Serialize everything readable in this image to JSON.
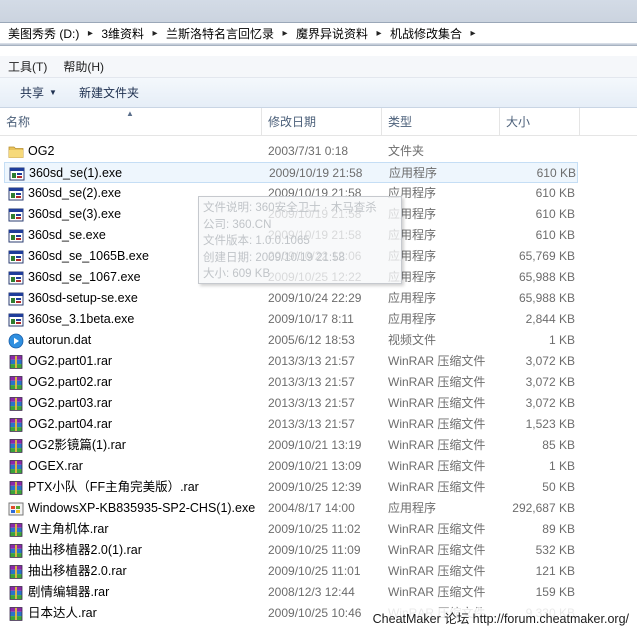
{
  "breadcrumb": [
    "美图秀秀 (D:)",
    "3维资料",
    "兰斯洛特名言回忆录",
    "魔界异说资料",
    "机战修改集合"
  ],
  "menu": [
    "工具(T)",
    "帮助(H)"
  ],
  "toolbar": {
    "share": "共享",
    "new_folder": "新建文件夹"
  },
  "columns": {
    "name": "名称",
    "date": "修改日期",
    "type": "类型",
    "size": "大小"
  },
  "files": [
    {
      "name": "OG2",
      "date": "2003/7/31 0:18",
      "type": "文件夹",
      "size": "",
      "icon": "folder"
    },
    {
      "name": "360sd_se(1).exe",
      "date": "2009/10/19 21:58",
      "type": "应用程序",
      "size": "610 KB",
      "icon": "exe"
    },
    {
      "name": "360sd_se(2).exe",
      "date": "2009/10/19 21:58",
      "type": "应用程序",
      "size": "610 KB",
      "icon": "exe"
    },
    {
      "name": "360sd_se(3).exe",
      "date": "2009/10/19 21:58",
      "type": "应用程序",
      "size": "610 KB",
      "icon": "exe"
    },
    {
      "name": "360sd_se.exe",
      "date": "2009/10/19 21:58",
      "type": "应用程序",
      "size": "610 KB",
      "icon": "exe"
    },
    {
      "name": "360sd_se_1065B.exe",
      "date": "2009/10/22 12:06",
      "type": "应用程序",
      "size": "65,769 KB",
      "icon": "exe"
    },
    {
      "name": "360sd_se_1067.exe",
      "date": "2009/10/25 12:22",
      "type": "应用程序",
      "size": "65,988 KB",
      "icon": "exe"
    },
    {
      "name": "360sd-setup-se.exe",
      "date": "2009/10/24 22:29",
      "type": "应用程序",
      "size": "65,988 KB",
      "icon": "exe"
    },
    {
      "name": "360se_3.1beta.exe",
      "date": "2009/10/17 8:11",
      "type": "应用程序",
      "size": "2,844 KB",
      "icon": "exe"
    },
    {
      "name": "autorun.dat",
      "date": "2005/6/12 18:53",
      "type": "视频文件",
      "size": "1 KB",
      "icon": "video"
    },
    {
      "name": "OG2.part01.rar",
      "date": "2013/3/13 21:57",
      "type": "WinRAR 压缩文件",
      "size": "3,072 KB",
      "icon": "rar"
    },
    {
      "name": "OG2.part02.rar",
      "date": "2013/3/13 21:57",
      "type": "WinRAR 压缩文件",
      "size": "3,072 KB",
      "icon": "rar"
    },
    {
      "name": "OG2.part03.rar",
      "date": "2013/3/13 21:57",
      "type": "WinRAR 压缩文件",
      "size": "3,072 KB",
      "icon": "rar"
    },
    {
      "name": "OG2.part04.rar",
      "date": "2013/3/13 21:57",
      "type": "WinRAR 压缩文件",
      "size": "1,523 KB",
      "icon": "rar"
    },
    {
      "name": "OG2影镜篇(1).rar",
      "date": "2009/10/21 13:19",
      "type": "WinRAR 压缩文件",
      "size": "85 KB",
      "icon": "rar"
    },
    {
      "name": "OGEX.rar",
      "date": "2009/10/21 13:09",
      "type": "WinRAR 压缩文件",
      "size": "1 KB",
      "icon": "rar"
    },
    {
      "name": "PTX小队（FF主角完美版）.rar",
      "date": "2009/10/25 12:39",
      "type": "WinRAR 压缩文件",
      "size": "50 KB",
      "icon": "rar"
    },
    {
      "name": "WindowsXP-KB835935-SP2-CHS(1).exe",
      "date": "2004/8/17 14:00",
      "type": "应用程序",
      "size": "292,687 KB",
      "icon": "win"
    },
    {
      "name": "W主角机体.rar",
      "date": "2009/10/25 11:02",
      "type": "WinRAR 压缩文件",
      "size": "89 KB",
      "icon": "rar"
    },
    {
      "name": "抽出移植器2.0(1).rar",
      "date": "2009/10/25 11:09",
      "type": "WinRAR 压缩文件",
      "size": "532 KB",
      "icon": "rar"
    },
    {
      "name": "抽出移植器2.0.rar",
      "date": "2009/10/25 11:01",
      "type": "WinRAR 压缩文件",
      "size": "121 KB",
      "icon": "rar"
    },
    {
      "name": "剧情编辑器.rar",
      "date": "2008/12/3 12:44",
      "type": "WinRAR 压缩文件",
      "size": "159 KB",
      "icon": "rar"
    },
    {
      "name": "日本达人.rar",
      "date": "2009/10/25 10:46",
      "type": "WinRAR 压缩文件",
      "size": "9,330 KB",
      "icon": "rar"
    }
  ],
  "tooltip": {
    "lines": [
      "文件说明: 360安全卫士 · 木马查杀",
      "公司: 360.CN",
      "文件版本: 1.0.0.1065",
      "创建日期: 2009/10/19 21:58",
      "大小: 609 KB"
    ]
  },
  "watermark": "CheatMaker 论坛 http://forum.cheatmaker.org/"
}
